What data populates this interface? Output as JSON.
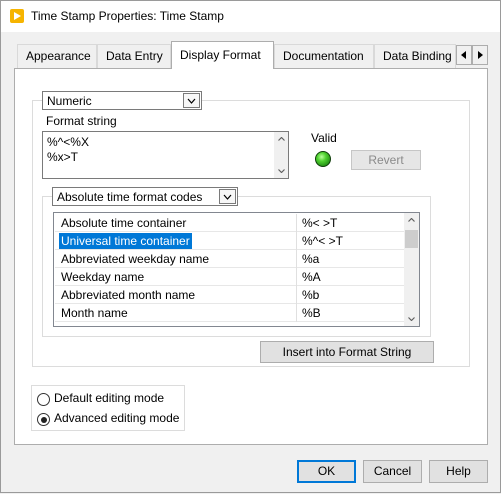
{
  "window": {
    "title": "Time Stamp Properties: Time Stamp",
    "colors": {
      "accent": "#0078d7",
      "app_icon": "#f6b400",
      "led_on": "#4fd130"
    }
  },
  "tabs": [
    {
      "label": "Appearance",
      "active": false
    },
    {
      "label": "Data Entry",
      "active": false
    },
    {
      "label": "Display Format",
      "active": true
    },
    {
      "label": "Documentation",
      "active": false
    },
    {
      "label": "Data Binding",
      "active": false
    }
  ],
  "format_type": {
    "selected": "Numeric"
  },
  "format_string": {
    "label": "Format string",
    "lines": [
      "%^<%X",
      "%x>T"
    ]
  },
  "valid": {
    "label": "Valid",
    "state": true
  },
  "revert_button": {
    "label": "Revert"
  },
  "codes_dropdown": {
    "selected": "Absolute time format codes"
  },
  "codes_table": {
    "rows": [
      {
        "name": "Absolute time container",
        "code": "%< >T"
      },
      {
        "name": "Universal time container",
        "code": "%^< >T"
      },
      {
        "name": "Abbreviated weekday name",
        "code": "%a"
      },
      {
        "name": "Weekday name",
        "code": "%A"
      },
      {
        "name": "Abbreviated month name",
        "code": "%b"
      },
      {
        "name": "Month name",
        "code": "%B"
      }
    ],
    "selected_index": 1
  },
  "insert_button": {
    "label": "Insert into Format String"
  },
  "editing_mode": {
    "options": [
      {
        "label": "Default editing mode",
        "checked": false
      },
      {
        "label": "Advanced editing mode",
        "checked": true
      }
    ]
  },
  "footer": {
    "ok_label": "OK",
    "cancel_label": "Cancel",
    "help_label": "Help"
  }
}
